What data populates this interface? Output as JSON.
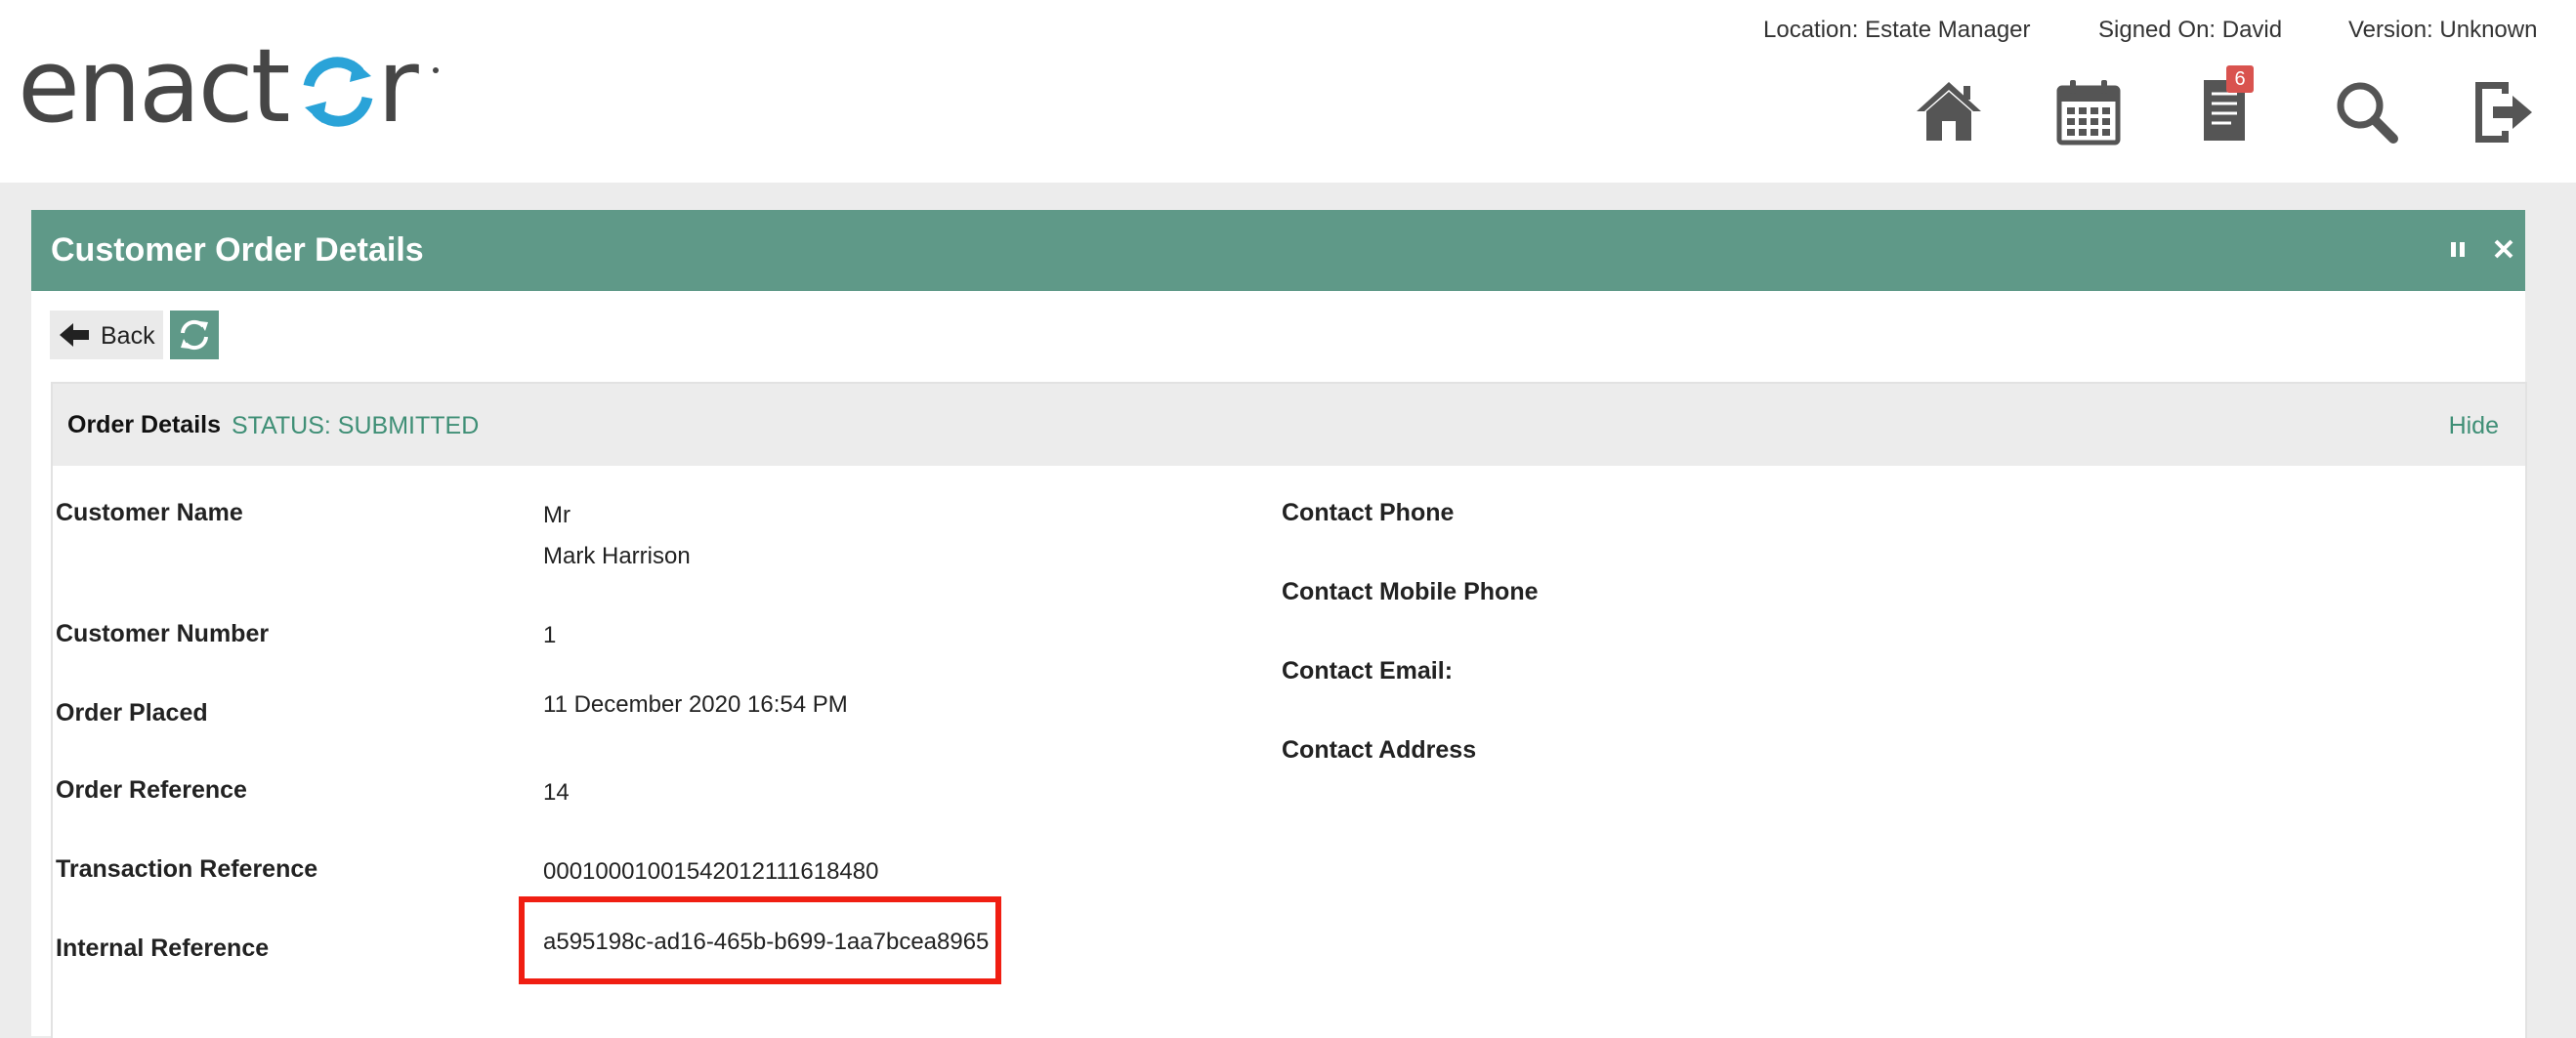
{
  "header": {
    "brand": "enactor",
    "location": "Location: Estate Manager",
    "signed_on": "Signed On: David",
    "version": "Version: Unknown",
    "icons": [
      "home-icon",
      "calendar-icon",
      "document-icon",
      "search-icon",
      "logout-icon"
    ],
    "notification_count": "6"
  },
  "panel": {
    "title": "Customer Order Details",
    "back_label": "Back",
    "section": {
      "title": "Order Details",
      "status": "STATUS: SUBMITTED",
      "hide_label": "Hide"
    },
    "fields_left": {
      "customer_name_label": "Customer Name",
      "customer_title": "Mr",
      "customer_name": "Mark Harrison",
      "customer_number_label": "Customer Number",
      "customer_number": "1",
      "order_placed_label": "Order Placed",
      "order_placed": "11 December 2020 16:54 PM",
      "order_reference_label": "Order Reference",
      "order_reference": "14",
      "transaction_reference_label": "Transaction Reference",
      "transaction_reference": "000100010015420121116184​80",
      "internal_reference_label": "Internal Reference",
      "internal_reference": "a595198c-ad16-465b-b699-1aa7bcea8965"
    },
    "fields_right": {
      "contact_phone_label": "Contact Phone",
      "contact_mobile_label": "Contact Mobile Phone",
      "contact_email_label": "Contact Email:",
      "contact_address_label": "Contact Address"
    }
  },
  "colors": {
    "accent": "#5f9988",
    "status_text": "#3f8f76",
    "highlight": "#f01e12",
    "logo_blue": "#2aa3d8"
  }
}
